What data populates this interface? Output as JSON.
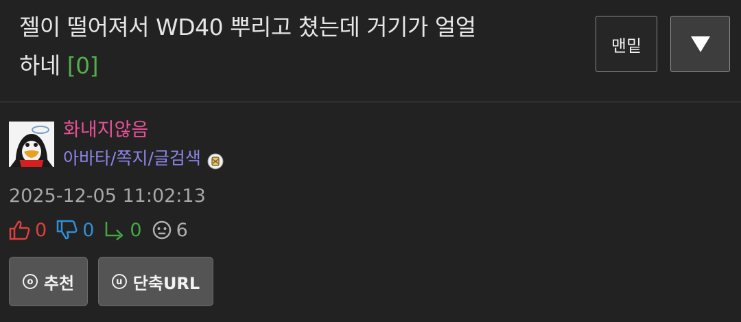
{
  "post": {
    "title": "젤이 떨어져서 WD40 뿌리고 쳤는데 거기가 얼얼하네",
    "comment_count": "[0]",
    "bottom_button": "맨밑",
    "date": "2025-12-05 11:02:13"
  },
  "author": {
    "name": "화내지않음",
    "links": [
      "아바타",
      "쪽지",
      "글검색"
    ],
    "separator": "/"
  },
  "reactions": {
    "likes": "0",
    "dislikes": "0",
    "replies": "0",
    "views": "6"
  },
  "actions": {
    "recommend_label": "추천",
    "recommend_icon_letter": "o",
    "shorturl_label": "단축URL",
    "shorturl_icon_letter": "u"
  },
  "icons": {
    "menu": "triangle-down-icon",
    "like": "thumbs-up-icon",
    "dislike": "thumbs-down-icon",
    "reply": "reply-arrow-icon",
    "view": "face-icon",
    "level": "level-badge-icon"
  },
  "colors": {
    "background": "#222222",
    "title": "#e6e6e6",
    "comment_count": "#52b04a",
    "author_name": "#e8519a",
    "author_links": "#8b86e8",
    "date": "#a8a8a8",
    "like": "#e0403c",
    "dislike": "#2f8fd8",
    "reply": "#43a843",
    "view": "#b0b0b0"
  }
}
